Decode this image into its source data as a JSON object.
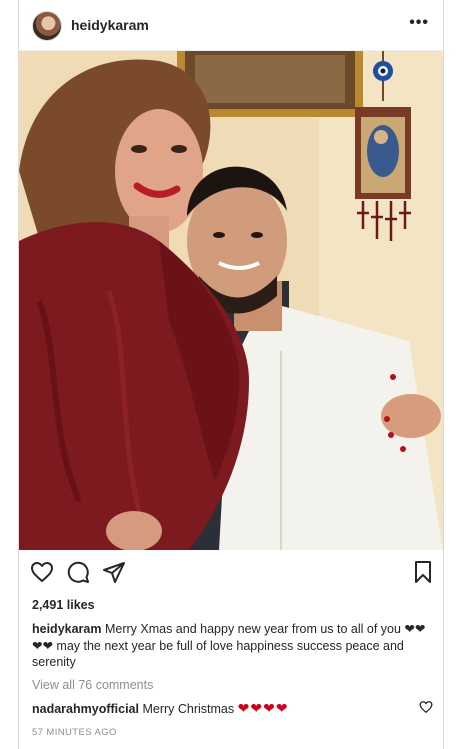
{
  "post": {
    "username": "heidykaram",
    "more_label": "•••",
    "likes": "2,491 likes",
    "caption_user": "heidykaram",
    "caption_text": "Merry Xmas and happy new year from us to all of you ❤❤❤❤ may the next year be full of love happiness success peace and serenity",
    "view_comments": "View all 76 comments",
    "comment": {
      "user": "nadarahmyofficial",
      "text": "Merry Christmas",
      "hearts": "❤❤❤❤"
    },
    "timestamp": "57 MINUTES AGO"
  },
  "icons": {
    "like": "heart-icon",
    "comment": "comment-icon",
    "share": "share-icon",
    "save": "bookmark-icon",
    "comment_like": "small-heart-icon"
  },
  "colors": {
    "text": "#262626",
    "muted": "#8e8e8e",
    "heart_red": "#d0021b",
    "border": "#dbdbdb"
  }
}
